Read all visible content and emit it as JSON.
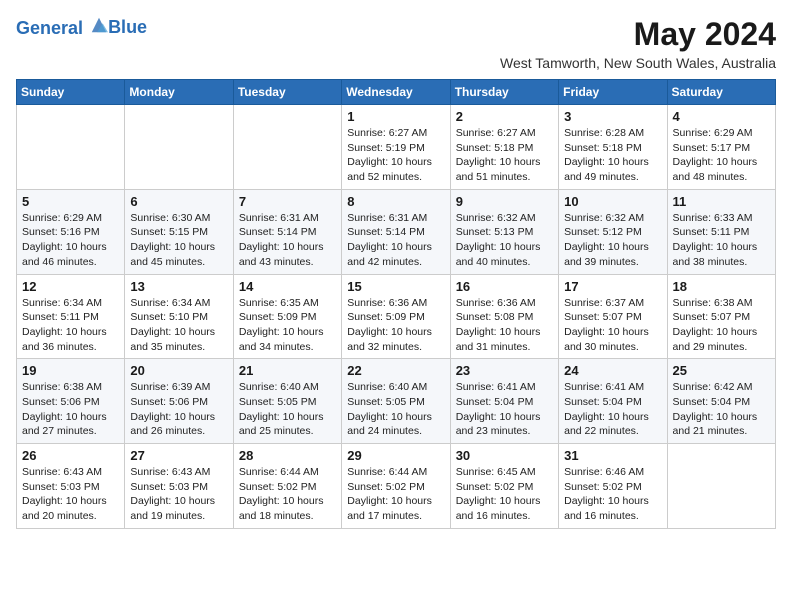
{
  "header": {
    "logo_line1": "General",
    "logo_line2": "Blue",
    "month_year": "May 2024",
    "location": "West Tamworth, New South Wales, Australia"
  },
  "days_of_week": [
    "Sunday",
    "Monday",
    "Tuesday",
    "Wednesday",
    "Thursday",
    "Friday",
    "Saturday"
  ],
  "weeks": [
    [
      {
        "day": "",
        "info": ""
      },
      {
        "day": "",
        "info": ""
      },
      {
        "day": "",
        "info": ""
      },
      {
        "day": "1",
        "info": "Sunrise: 6:27 AM\nSunset: 5:19 PM\nDaylight: 10 hours and 52 minutes."
      },
      {
        "day": "2",
        "info": "Sunrise: 6:27 AM\nSunset: 5:18 PM\nDaylight: 10 hours and 51 minutes."
      },
      {
        "day": "3",
        "info": "Sunrise: 6:28 AM\nSunset: 5:18 PM\nDaylight: 10 hours and 49 minutes."
      },
      {
        "day": "4",
        "info": "Sunrise: 6:29 AM\nSunset: 5:17 PM\nDaylight: 10 hours and 48 minutes."
      }
    ],
    [
      {
        "day": "5",
        "info": "Sunrise: 6:29 AM\nSunset: 5:16 PM\nDaylight: 10 hours and 46 minutes."
      },
      {
        "day": "6",
        "info": "Sunrise: 6:30 AM\nSunset: 5:15 PM\nDaylight: 10 hours and 45 minutes."
      },
      {
        "day": "7",
        "info": "Sunrise: 6:31 AM\nSunset: 5:14 PM\nDaylight: 10 hours and 43 minutes."
      },
      {
        "day": "8",
        "info": "Sunrise: 6:31 AM\nSunset: 5:14 PM\nDaylight: 10 hours and 42 minutes."
      },
      {
        "day": "9",
        "info": "Sunrise: 6:32 AM\nSunset: 5:13 PM\nDaylight: 10 hours and 40 minutes."
      },
      {
        "day": "10",
        "info": "Sunrise: 6:32 AM\nSunset: 5:12 PM\nDaylight: 10 hours and 39 minutes."
      },
      {
        "day": "11",
        "info": "Sunrise: 6:33 AM\nSunset: 5:11 PM\nDaylight: 10 hours and 38 minutes."
      }
    ],
    [
      {
        "day": "12",
        "info": "Sunrise: 6:34 AM\nSunset: 5:11 PM\nDaylight: 10 hours and 36 minutes."
      },
      {
        "day": "13",
        "info": "Sunrise: 6:34 AM\nSunset: 5:10 PM\nDaylight: 10 hours and 35 minutes."
      },
      {
        "day": "14",
        "info": "Sunrise: 6:35 AM\nSunset: 5:09 PM\nDaylight: 10 hours and 34 minutes."
      },
      {
        "day": "15",
        "info": "Sunrise: 6:36 AM\nSunset: 5:09 PM\nDaylight: 10 hours and 32 minutes."
      },
      {
        "day": "16",
        "info": "Sunrise: 6:36 AM\nSunset: 5:08 PM\nDaylight: 10 hours and 31 minutes."
      },
      {
        "day": "17",
        "info": "Sunrise: 6:37 AM\nSunset: 5:07 PM\nDaylight: 10 hours and 30 minutes."
      },
      {
        "day": "18",
        "info": "Sunrise: 6:38 AM\nSunset: 5:07 PM\nDaylight: 10 hours and 29 minutes."
      }
    ],
    [
      {
        "day": "19",
        "info": "Sunrise: 6:38 AM\nSunset: 5:06 PM\nDaylight: 10 hours and 27 minutes."
      },
      {
        "day": "20",
        "info": "Sunrise: 6:39 AM\nSunset: 5:06 PM\nDaylight: 10 hours and 26 minutes."
      },
      {
        "day": "21",
        "info": "Sunrise: 6:40 AM\nSunset: 5:05 PM\nDaylight: 10 hours and 25 minutes."
      },
      {
        "day": "22",
        "info": "Sunrise: 6:40 AM\nSunset: 5:05 PM\nDaylight: 10 hours and 24 minutes."
      },
      {
        "day": "23",
        "info": "Sunrise: 6:41 AM\nSunset: 5:04 PM\nDaylight: 10 hours and 23 minutes."
      },
      {
        "day": "24",
        "info": "Sunrise: 6:41 AM\nSunset: 5:04 PM\nDaylight: 10 hours and 22 minutes."
      },
      {
        "day": "25",
        "info": "Sunrise: 6:42 AM\nSunset: 5:04 PM\nDaylight: 10 hours and 21 minutes."
      }
    ],
    [
      {
        "day": "26",
        "info": "Sunrise: 6:43 AM\nSunset: 5:03 PM\nDaylight: 10 hours and 20 minutes."
      },
      {
        "day": "27",
        "info": "Sunrise: 6:43 AM\nSunset: 5:03 PM\nDaylight: 10 hours and 19 minutes."
      },
      {
        "day": "28",
        "info": "Sunrise: 6:44 AM\nSunset: 5:02 PM\nDaylight: 10 hours and 18 minutes."
      },
      {
        "day": "29",
        "info": "Sunrise: 6:44 AM\nSunset: 5:02 PM\nDaylight: 10 hours and 17 minutes."
      },
      {
        "day": "30",
        "info": "Sunrise: 6:45 AM\nSunset: 5:02 PM\nDaylight: 10 hours and 16 minutes."
      },
      {
        "day": "31",
        "info": "Sunrise: 6:46 AM\nSunset: 5:02 PM\nDaylight: 10 hours and 16 minutes."
      },
      {
        "day": "",
        "info": ""
      }
    ]
  ]
}
